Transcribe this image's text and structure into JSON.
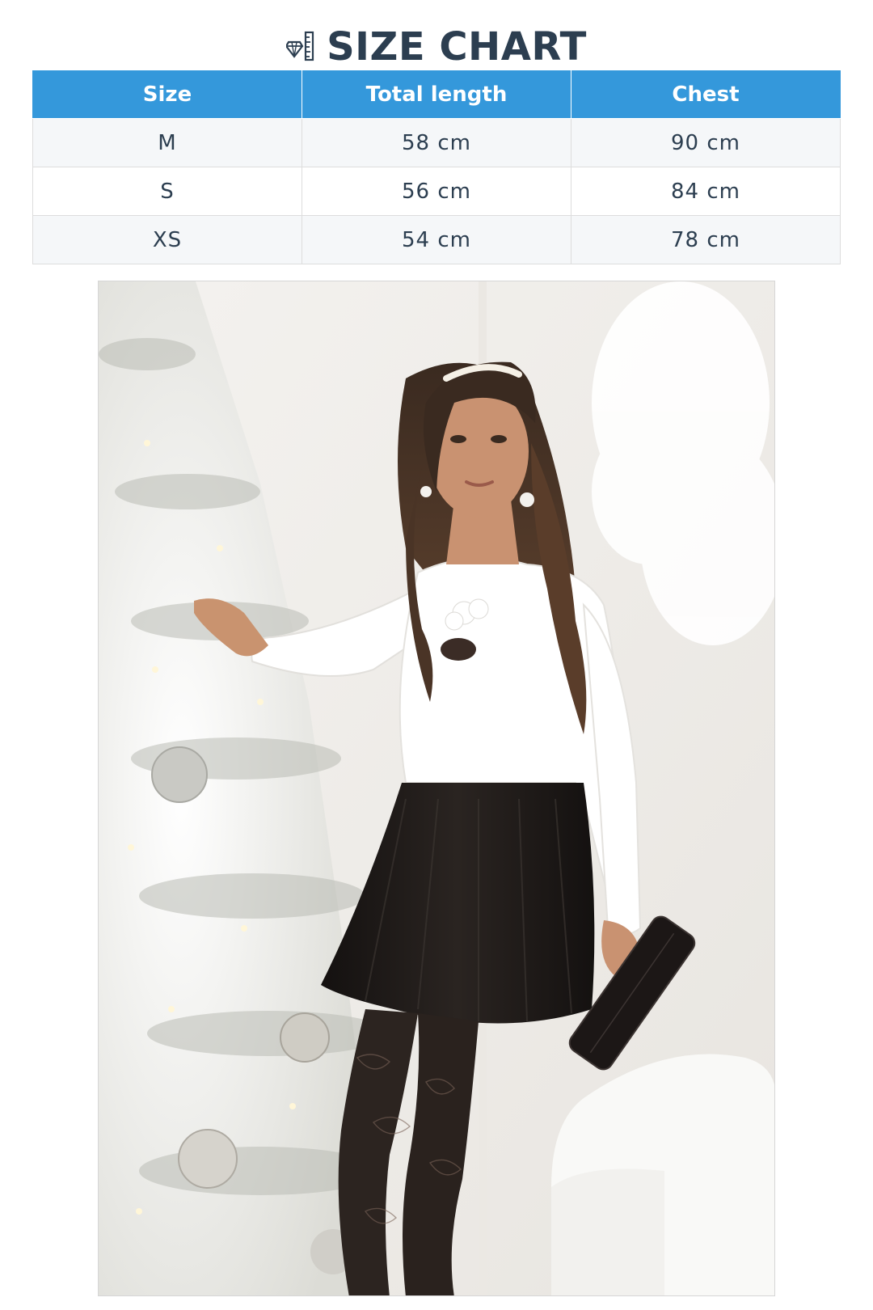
{
  "title": "SIZE CHART",
  "title_icon": "ruler-diamond-icon",
  "table": {
    "headers": [
      "Size",
      "Total length",
      "Chest"
    ],
    "rows": [
      [
        "M",
        "58 cm",
        "90 cm"
      ],
      [
        "S",
        "56 cm",
        "84 cm"
      ],
      [
        "XS",
        "54 cm",
        "78 cm"
      ]
    ]
  },
  "colors": {
    "header_bg": "#3498db",
    "title": "#2c3e50",
    "stripe": "#f5f7f9"
  },
  "photo": {
    "subject": "model-photo"
  }
}
